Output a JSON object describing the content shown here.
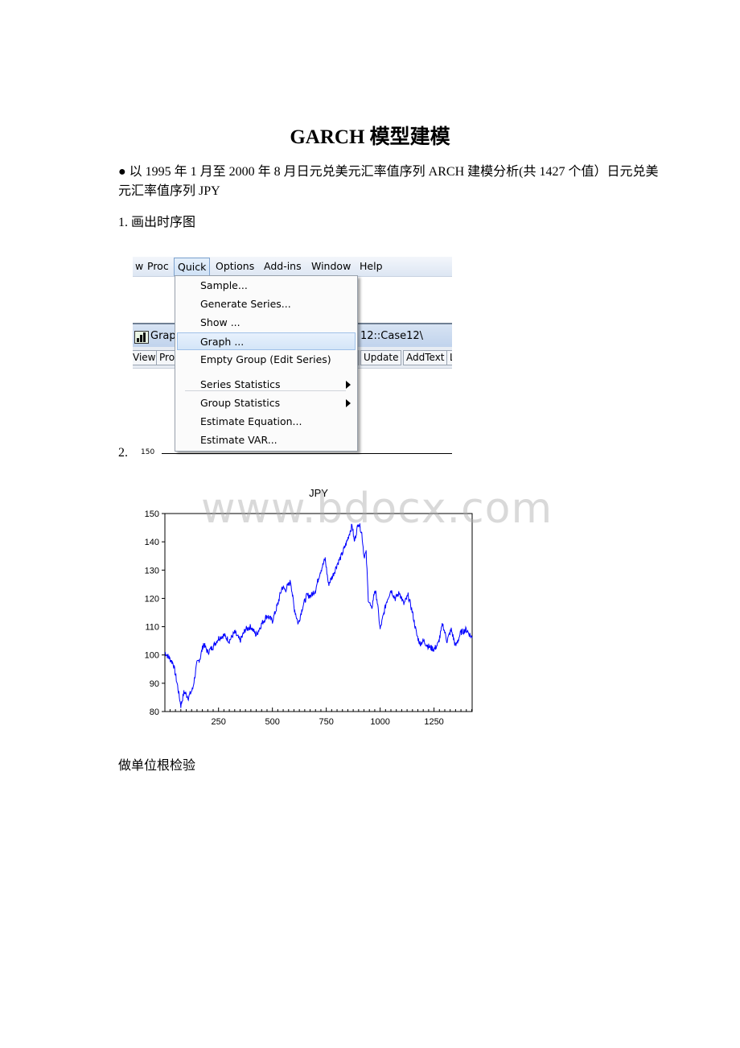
{
  "document": {
    "title": "GARCH 模型建模",
    "intro": "● 以 1995 年 1 月至 2000 年 8 月日元兑美元汇率值序列 ARCH 建模分析(共 1427 个值）日元兑美元汇率值序列 JPY",
    "step1": "1. 画出时序图",
    "step2": "2.",
    "step3": "做单位根检验",
    "watermark": "www.bdocx.com"
  },
  "screenshot": {
    "menubar": [
      "w",
      "Proc",
      "Quick",
      "Options",
      "Add-ins",
      "Window",
      "Help"
    ],
    "active_menu": "Quick",
    "window_title_left": "Grap",
    "window_title_right": "12::Case12\\",
    "toolbar_left": [
      "View",
      "Pro"
    ],
    "toolbar_right": [
      "Update",
      "AddText",
      "L"
    ],
    "quick_menu": [
      {
        "label": "Sample...",
        "submenu": false
      },
      {
        "label": "Generate Series...",
        "submenu": false
      },
      {
        "label": "Show ...",
        "submenu": false
      },
      {
        "label": "Graph ...",
        "submenu": false,
        "highlighted": true
      },
      {
        "label": "Empty Group (Edit Series)",
        "submenu": false
      },
      {
        "label": "Series Statistics",
        "submenu": true
      },
      {
        "label": "Group Statistics",
        "submenu": true
      },
      {
        "label": "Estimate Equation...",
        "submenu": false
      },
      {
        "label": "Estimate VAR...",
        "submenu": false
      }
    ],
    "clipped_axis_label": "150"
  },
  "chart_data": {
    "type": "line",
    "title": "JPY",
    "xlabel": "",
    "ylabel": "",
    "xlim": [
      1,
      1427
    ],
    "ylim": [
      80,
      150
    ],
    "xticks": [
      250,
      500,
      750,
      1000,
      1250
    ],
    "yticks": [
      80,
      90,
      100,
      110,
      120,
      130,
      140,
      150
    ],
    "grid": false,
    "line_color": "#0000ff",
    "series": [
      {
        "name": "JPY",
        "x": [
          1,
          20,
          40,
          60,
          75,
          90,
          110,
          130,
          150,
          165,
          180,
          200,
          225,
          250,
          275,
          300,
          325,
          350,
          375,
          400,
          425,
          450,
          475,
          500,
          525,
          545,
          560,
          585,
          600,
          620,
          640,
          660,
          680,
          700,
          720,
          745,
          760,
          780,
          800,
          820,
          845,
          870,
          880,
          900,
          915,
          925,
          935,
          945,
          960,
          975,
          985,
          1000,
          1015,
          1030,
          1050,
          1070,
          1090,
          1110,
          1130,
          1150,
          1170,
          1185,
          1200,
          1225,
          1250,
          1270,
          1290,
          1310,
          1330,
          1350,
          1375,
          1400,
          1427
        ],
        "values": [
          101,
          99,
          97,
          89,
          82,
          87,
          85,
          88,
          97,
          99,
          104,
          101,
          103,
          106,
          107,
          105,
          108,
          105,
          109,
          110,
          107,
          111,
          114,
          112,
          118,
          124,
          123,
          126,
          117,
          111,
          117,
          121,
          121,
          123,
          129,
          134,
          125,
          128,
          132,
          135,
          140,
          146,
          140,
          147,
          143,
          135,
          136,
          120,
          116,
          123,
          120,
          109,
          114,
          119,
          123,
          120,
          122,
          118,
          121,
          115,
          107,
          104,
          105,
          103,
          102,
          104,
          111,
          105,
          109,
          103,
          108,
          109,
          106
        ]
      }
    ]
  }
}
